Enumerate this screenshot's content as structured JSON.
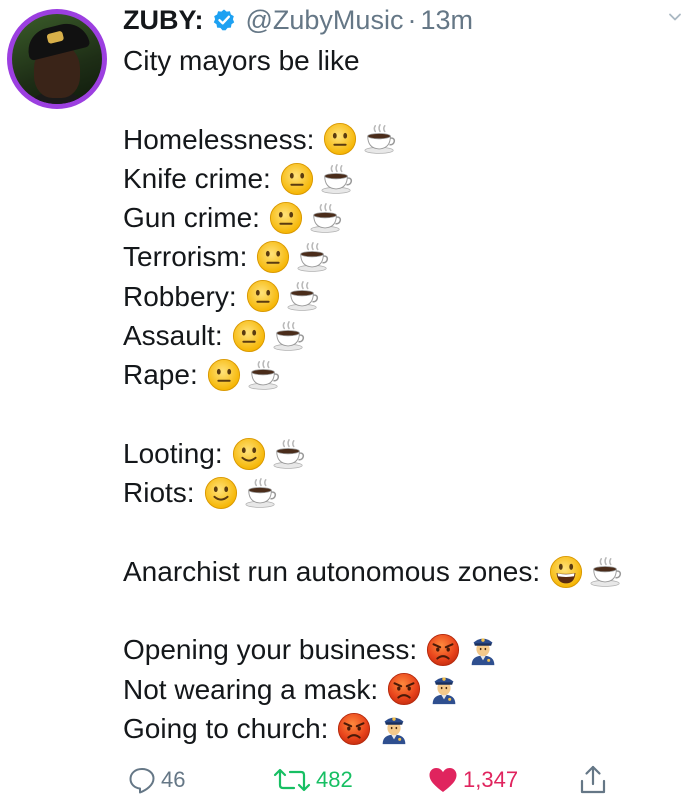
{
  "author": {
    "display_name": "ZUBY:",
    "handle": "@ZubyMusic",
    "separator": "·",
    "time": "13m",
    "verified": true
  },
  "tweet": {
    "intro": "City mayors be like",
    "group1": [
      {
        "label": "Homelessness:",
        "emojis": [
          "neutral-face",
          "hot-beverage"
        ]
      },
      {
        "label": "Knife crime:",
        "emojis": [
          "neutral-face",
          "hot-beverage"
        ]
      },
      {
        "label": "Gun crime:",
        "emojis": [
          "neutral-face",
          "hot-beverage"
        ]
      },
      {
        "label": "Terrorism:",
        "emojis": [
          "neutral-face",
          "hot-beverage"
        ]
      },
      {
        "label": "Robbery:",
        "emojis": [
          "neutral-face",
          "hot-beverage"
        ]
      },
      {
        "label": "Assault:",
        "emojis": [
          "neutral-face",
          "hot-beverage"
        ]
      },
      {
        "label": "Rape:",
        "emojis": [
          "neutral-face",
          "hot-beverage"
        ]
      }
    ],
    "group2": [
      {
        "label": "Looting:",
        "emojis": [
          "slightly-smiling-face",
          "hot-beverage"
        ]
      },
      {
        "label": "Riots:",
        "emojis": [
          "slightly-smiling-face",
          "hot-beverage"
        ]
      }
    ],
    "group3": [
      {
        "label": "Anarchist run autonomous zones:",
        "emojis": [
          "grinning-face",
          "hot-beverage"
        ]
      }
    ],
    "group4": [
      {
        "label": "Opening your business:",
        "emojis": [
          "angry-face",
          "police-officer"
        ]
      },
      {
        "label": "Not wearing a mask:",
        "emojis": [
          "angry-face",
          "police-officer"
        ]
      },
      {
        "label": "Going to church:",
        "emojis": [
          "angry-face",
          "police-officer"
        ]
      }
    ]
  },
  "actions": {
    "replies": "46",
    "retweets": "482",
    "likes": "1,347"
  },
  "colors": {
    "retweet": "#17bf63",
    "like": "#e0245e",
    "muted": "#657786",
    "verified": "#1da1f2"
  }
}
